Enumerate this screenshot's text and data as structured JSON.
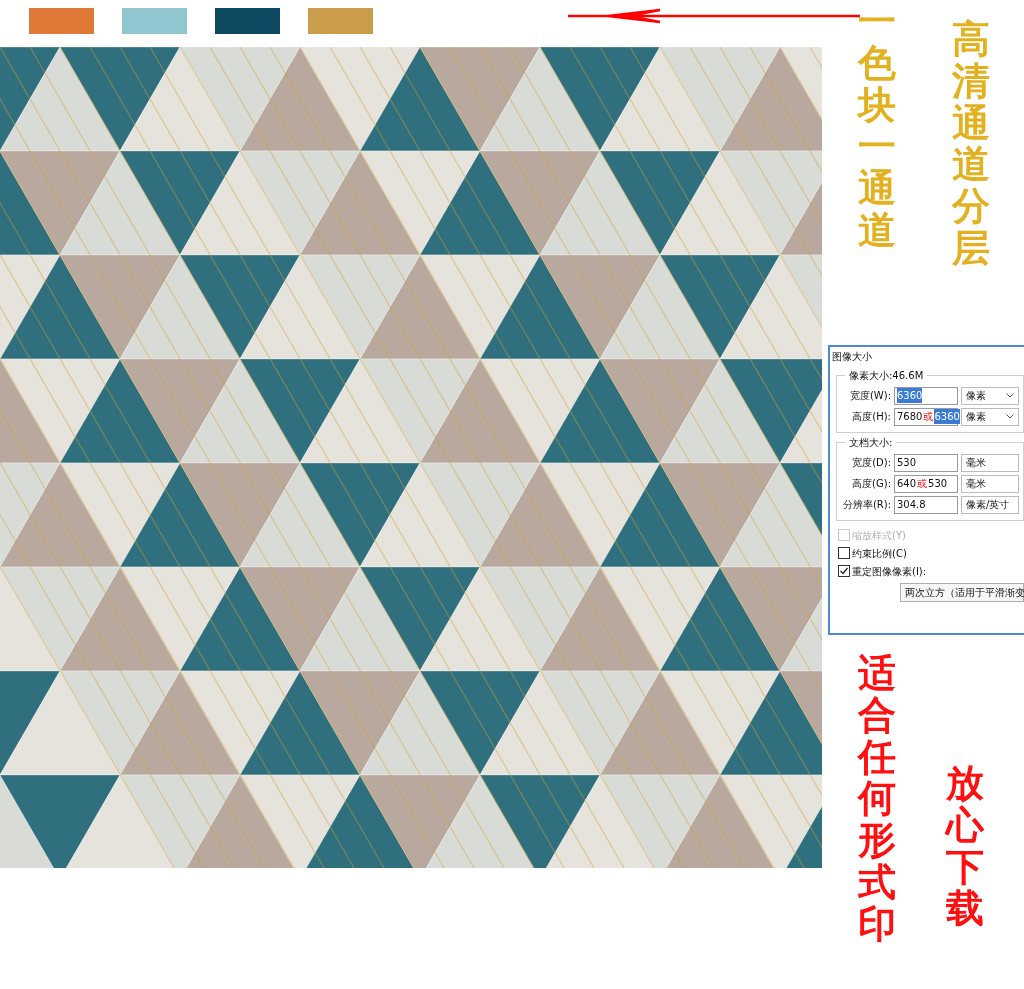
{
  "swatches": [
    {
      "color": "#e07838"
    },
    {
      "color": "#8fc6cf"
    },
    {
      "color": "#0d4a62"
    },
    {
      "color": "#c99d4a"
    }
  ],
  "captions": [
    {
      "text": "一色块一通道",
      "color": "#e3b11f"
    },
    {
      "text": "高清通道分层",
      "color": "#e3b11f"
    },
    {
      "text": "适合任何形式印",
      "color": "#ff1010"
    },
    {
      "text": "放心下载",
      "color": "#ff1010"
    }
  ],
  "dialog": {
    "title": "图像大小",
    "pixel_group": {
      "label": "像素大小:46.6M",
      "rows": [
        {
          "label": "宽度(W):",
          "value": "6360",
          "selected": true,
          "unit": "像素",
          "dropdown": true
        },
        {
          "label": "高度(H):",
          "value": "7680",
          "mark": "或",
          "new_value": "6360",
          "selected": true,
          "unit": "像素",
          "dropdown": true
        }
      ]
    },
    "document_group": {
      "label": "文档大小:",
      "rows": [
        {
          "label": "宽度(D):",
          "value": "530",
          "selected": false,
          "unit": "毫米",
          "dropdown": false
        },
        {
          "label": "高度(G):",
          "value": "640",
          "mark": "或",
          "new_value": "530",
          "selected": false,
          "unit": "毫米",
          "dropdown": false
        },
        {
          "label": "分辨率(R):",
          "value": "304.8",
          "selected": false,
          "unit": "像素/英寸",
          "dropdown": false
        }
      ]
    },
    "checkboxes": [
      {
        "label": "缩放样式(Y)",
        "checked": false,
        "disabled": true
      },
      {
        "label": "约束比例(C)",
        "checked": false,
        "disabled": false
      },
      {
        "label": "重定图像像素(I):",
        "checked": true,
        "disabled": false
      }
    ],
    "resample": "两次立方（适用于平滑渐变"
  }
}
